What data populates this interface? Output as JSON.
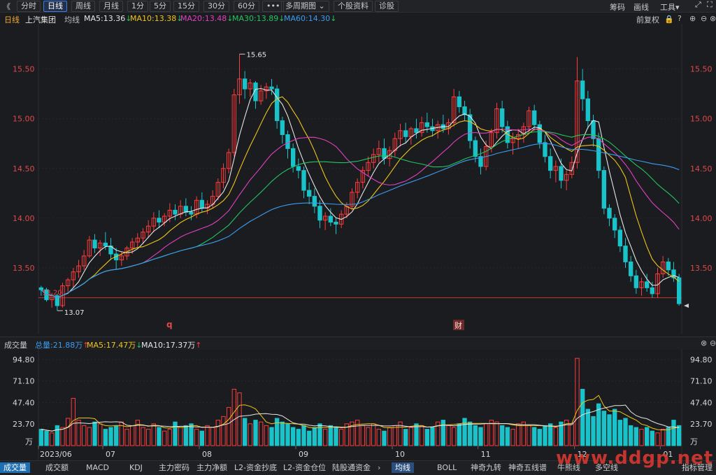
{
  "toolbar": {
    "back": "《",
    "periods": [
      "分时",
      "日线",
      "周线",
      "月线",
      "1分",
      "5分",
      "15分",
      "30分",
      "60分"
    ],
    "active_period": "日线",
    "more": "•••",
    "multi_period": "多周期图",
    "stock_info": "个股资料",
    "diagnose": "诊股",
    "right_items": [
      "筹码",
      "画线",
      "工具"
    ]
  },
  "indicator_line": {
    "period": "日线",
    "stock_name": "上汽集团",
    "ma_label": "均线",
    "ma": [
      {
        "label": "MA5:13.36",
        "arrow": "↓",
        "color": "#e6e6e6"
      },
      {
        "label": "MA10:13.38",
        "arrow": "↓",
        "color": "#f0c419"
      },
      {
        "label": "MA20:13.48",
        "arrow": "↓",
        "color": "#e040c0"
      },
      {
        "label": "MA30:13.89",
        "arrow": "↓",
        "color": "#22c55e"
      },
      {
        "label": "MA60:14.30",
        "arrow": "↓",
        "color": "#3b9cf0"
      }
    ],
    "right_label": "前复权"
  },
  "chart_data": [
    {
      "type": "candlestick",
      "title": "上汽集团 日线",
      "y_ticks": [
        "15.50",
        "15.00",
        "14.50",
        "14.00",
        "13.50"
      ],
      "ylim": [
        13.0,
        15.8
      ],
      "annotations": {
        "high": "15.65",
        "low": "13.07",
        "left_label": "13.20",
        "marker_q": "q",
        "marker_cai": "财"
      },
      "horizontal_line": 13.2,
      "candles_ohlc": [
        [
          13.3,
          13.32,
          13.22,
          13.28
        ],
        [
          13.28,
          13.3,
          13.16,
          13.18
        ],
        [
          13.18,
          13.25,
          13.1,
          13.22
        ],
        [
          13.22,
          13.24,
          13.07,
          13.12
        ],
        [
          13.12,
          13.35,
          13.1,
          13.32
        ],
        [
          13.32,
          13.4,
          13.26,
          13.38
        ],
        [
          13.38,
          13.5,
          13.3,
          13.46
        ],
        [
          13.46,
          13.58,
          13.4,
          13.52
        ],
        [
          13.52,
          13.68,
          13.48,
          13.62
        ],
        [
          13.62,
          13.82,
          13.6,
          13.78
        ],
        [
          13.78,
          13.84,
          13.65,
          13.7
        ],
        [
          13.7,
          13.78,
          13.62,
          13.75
        ],
        [
          13.75,
          13.86,
          13.68,
          13.72
        ],
        [
          13.72,
          13.8,
          13.58,
          13.64
        ],
        [
          13.64,
          13.7,
          13.48,
          13.58
        ],
        [
          13.58,
          13.66,
          13.52,
          13.62
        ],
        [
          13.62,
          13.72,
          13.58,
          13.7
        ],
        [
          13.7,
          13.8,
          13.64,
          13.76
        ],
        [
          13.76,
          13.85,
          13.7,
          13.8
        ],
        [
          13.8,
          13.9,
          13.74,
          13.86
        ],
        [
          13.86,
          13.98,
          13.8,
          13.92
        ],
        [
          13.92,
          14.06,
          13.86,
          14.0
        ],
        [
          14.0,
          14.08,
          13.9,
          13.96
        ],
        [
          13.96,
          14.05,
          13.92,
          14.02
        ],
        [
          14.02,
          14.15,
          13.96,
          14.08
        ],
        [
          14.08,
          14.14,
          13.98,
          14.04
        ],
        [
          14.04,
          14.18,
          14.0,
          14.12
        ],
        [
          14.12,
          14.2,
          14.02,
          14.06
        ],
        [
          14.06,
          14.12,
          13.98,
          14.04
        ],
        [
          14.04,
          14.22,
          14.0,
          14.18
        ],
        [
          14.18,
          14.26,
          14.06,
          14.1
        ],
        [
          14.1,
          14.18,
          14.04,
          14.14
        ],
        [
          14.14,
          14.28,
          14.1,
          14.22
        ],
        [
          14.22,
          14.4,
          14.18,
          14.36
        ],
        [
          14.36,
          14.55,
          14.3,
          14.5
        ],
        [
          14.5,
          14.7,
          14.45,
          14.66
        ],
        [
          14.66,
          15.3,
          14.62,
          15.24
        ],
        [
          15.24,
          15.65,
          15.15,
          15.4
        ],
        [
          15.4,
          15.48,
          15.2,
          15.3
        ],
        [
          15.3,
          15.4,
          15.22,
          15.36
        ],
        [
          15.36,
          15.38,
          15.1,
          15.18
        ],
        [
          15.18,
          15.34,
          15.14,
          15.28
        ],
        [
          15.28,
          15.36,
          15.2,
          15.32
        ],
        [
          15.32,
          15.4,
          15.24,
          15.3
        ],
        [
          15.3,
          15.34,
          14.9,
          14.98
        ],
        [
          14.98,
          15.02,
          14.75,
          14.84
        ],
        [
          14.84,
          14.88,
          14.6,
          14.7
        ],
        [
          14.7,
          14.75,
          14.46,
          14.52
        ],
        [
          14.52,
          14.6,
          14.4,
          14.48
        ],
        [
          14.48,
          14.52,
          14.2,
          14.28
        ],
        [
          14.28,
          14.36,
          14.14,
          14.22
        ],
        [
          14.22,
          14.3,
          14.05,
          14.12
        ],
        [
          14.12,
          14.18,
          13.9,
          13.98
        ],
        [
          13.98,
          14.06,
          13.88,
          14.02
        ],
        [
          14.02,
          14.1,
          13.92,
          13.96
        ],
        [
          13.96,
          14.0,
          13.84,
          13.94
        ],
        [
          13.94,
          14.08,
          13.9,
          14.04
        ],
        [
          14.04,
          14.16,
          14.0,
          14.12
        ],
        [
          14.12,
          14.3,
          14.08,
          14.26
        ],
        [
          14.26,
          14.4,
          14.2,
          14.36
        ],
        [
          14.36,
          14.52,
          14.3,
          14.48
        ],
        [
          14.48,
          14.62,
          14.42,
          14.56
        ],
        [
          14.56,
          14.7,
          14.5,
          14.64
        ],
        [
          14.64,
          14.78,
          14.56,
          14.7
        ],
        [
          14.7,
          14.8,
          14.54,
          14.6
        ],
        [
          14.6,
          14.72,
          14.52,
          14.68
        ],
        [
          14.68,
          14.86,
          14.62,
          14.8
        ],
        [
          14.8,
          14.95,
          14.72,
          14.88
        ],
        [
          14.88,
          14.96,
          14.76,
          14.82
        ],
        [
          14.82,
          14.92,
          14.74,
          14.9
        ],
        [
          14.9,
          15.0,
          14.8,
          14.86
        ],
        [
          14.86,
          15.02,
          14.82,
          14.96
        ],
        [
          14.96,
          15.06,
          14.86,
          14.92
        ],
        [
          14.92,
          15.0,
          14.82,
          14.88
        ],
        [
          14.88,
          14.98,
          14.8,
          14.94
        ],
        [
          14.94,
          15.04,
          14.86,
          14.9
        ],
        [
          14.9,
          15.0,
          14.84,
          14.96
        ],
        [
          14.96,
          15.3,
          14.92,
          15.22
        ],
        [
          15.22,
          15.28,
          15.06,
          15.12
        ],
        [
          15.12,
          15.18,
          14.98,
          15.04
        ],
        [
          15.04,
          15.1,
          14.7,
          14.78
        ],
        [
          14.78,
          14.82,
          14.56,
          14.62
        ],
        [
          14.62,
          14.7,
          14.44,
          14.52
        ],
        [
          14.52,
          14.78,
          14.48,
          14.72
        ],
        [
          14.72,
          14.9,
          14.66,
          14.86
        ],
        [
          14.86,
          15.16,
          14.8,
          15.1
        ],
        [
          15.1,
          15.18,
          14.86,
          14.92
        ],
        [
          14.92,
          14.98,
          14.7,
          14.76
        ],
        [
          14.76,
          14.86,
          14.64,
          14.8
        ],
        [
          14.8,
          14.9,
          14.7,
          14.84
        ],
        [
          14.84,
          14.96,
          14.76,
          14.92
        ],
        [
          14.92,
          15.12,
          14.86,
          15.08
        ],
        [
          15.08,
          15.14,
          14.88,
          14.94
        ],
        [
          14.94,
          14.98,
          14.7,
          14.76
        ],
        [
          14.76,
          14.84,
          14.56,
          14.62
        ],
        [
          14.62,
          14.7,
          14.4,
          14.48
        ],
        [
          14.48,
          14.58,
          14.36,
          14.52
        ],
        [
          14.52,
          14.6,
          14.3,
          14.38
        ],
        [
          14.38,
          14.48,
          14.28,
          14.44
        ],
        [
          14.44,
          14.62,
          14.4,
          14.56
        ],
        [
          14.56,
          15.62,
          14.5,
          15.38
        ],
        [
          15.38,
          15.5,
          15.08,
          15.2
        ],
        [
          15.2,
          15.28,
          14.9,
          14.98
        ],
        [
          14.98,
          15.04,
          14.72,
          14.8
        ],
        [
          14.8,
          14.86,
          14.4,
          14.48
        ],
        [
          14.48,
          14.52,
          14.04,
          14.1
        ],
        [
          14.1,
          14.14,
          13.92,
          14.0
        ],
        [
          14.0,
          14.04,
          13.8,
          13.88
        ],
        [
          13.88,
          13.92,
          13.66,
          13.72
        ],
        [
          13.72,
          13.8,
          13.5,
          13.56
        ],
        [
          13.56,
          13.62,
          13.36,
          13.42
        ],
        [
          13.42,
          13.48,
          13.24,
          13.3
        ],
        [
          13.3,
          13.4,
          13.22,
          13.36
        ],
        [
          13.36,
          13.44,
          13.26,
          13.3
        ],
        [
          13.3,
          13.36,
          13.2,
          13.24
        ],
        [
          13.24,
          13.5,
          13.2,
          13.44
        ],
        [
          13.44,
          13.62,
          13.4,
          13.56
        ],
        [
          13.56,
          13.6,
          13.42,
          13.48
        ],
        [
          13.48,
          13.56,
          13.36,
          13.4
        ],
        [
          13.4,
          13.44,
          13.12,
          13.14
        ]
      ]
    },
    {
      "type": "bar",
      "title": "成交量",
      "y_ticks": [
        "94.80",
        "71.10",
        "47.40",
        "23.70"
      ],
      "unit": "万",
      "ylim": [
        0,
        100
      ],
      "x_labels": [
        "2023/06",
        "07",
        "08",
        "09",
        "10",
        "11",
        "12",
        "01"
      ],
      "volume": [
        18,
        16,
        14,
        22,
        20,
        30,
        52,
        28,
        22,
        20,
        26,
        24,
        18,
        20,
        22,
        26,
        18,
        22,
        28,
        20,
        18,
        24,
        20,
        16,
        18,
        26,
        20,
        22,
        24,
        18,
        16,
        22,
        20,
        28,
        32,
        42,
        62,
        58,
        30,
        24,
        28,
        26,
        22,
        20,
        30,
        26,
        24,
        20,
        18,
        22,
        16,
        20,
        24,
        18,
        22,
        20,
        18,
        24,
        26,
        28,
        22,
        20,
        24,
        18,
        16,
        20,
        22,
        26,
        18,
        20,
        24,
        22,
        18,
        20,
        26,
        28,
        22,
        20,
        24,
        30,
        26,
        22,
        20,
        24,
        28,
        26,
        22,
        20,
        18,
        24,
        26,
        22,
        20,
        18,
        22,
        24,
        20,
        26,
        28,
        24,
        96,
        62,
        40,
        32,
        46,
        38,
        34,
        40,
        28,
        30,
        22,
        20,
        18,
        20,
        16,
        14,
        18,
        20,
        28,
        22
      ]
    }
  ],
  "volume_header": {
    "title": "成交量",
    "total": "总量:21.88万",
    "ma5": "MA5:17.47万",
    "ma10": "MA10:17.37万"
  },
  "bottom_tabs_left": [
    "成交量",
    "成交额",
    "MACD",
    "KDJ",
    "主力密码",
    "主力净额",
    "L2-资金抄底",
    "L2-资金仓位",
    "陆股通资金"
  ],
  "bottom_tabs_right": [
    "均线",
    "BOLL",
    "神奇九转",
    "神奇五线谱",
    "牛熊线",
    "多空线",
    "指标管理"
  ],
  "watermark": "www.ddgp.net",
  "colors": {
    "up": "#ff3b3b",
    "down": "#19c3c9",
    "ma5": "#e6e6e6",
    "ma10": "#f0c419",
    "ma20": "#e040c0",
    "ma30": "#22c55e",
    "ma60": "#3b9cf0"
  }
}
